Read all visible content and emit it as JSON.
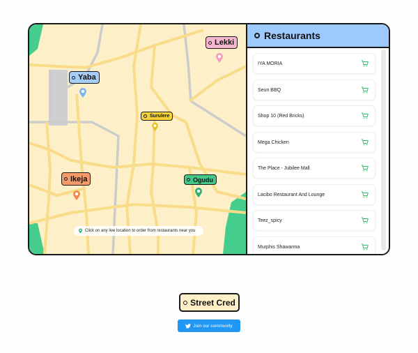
{
  "map": {
    "locations": [
      {
        "label": "Yaba",
        "color": "#a7cdf6",
        "marker_color": "#7ab6f0"
      },
      {
        "label": "Lekki",
        "color": "#f5b6cf",
        "marker_color": "#ef9fbe"
      },
      {
        "label": "Surulere",
        "color": "#f5d235",
        "marker_color": "#e6c229"
      },
      {
        "label": "Ikeja",
        "color": "#f79a6a",
        "marker_color": "#f2884f"
      },
      {
        "label": "Ogudu",
        "color": "#44c88a",
        "marker_color": "#2fb070"
      }
    ],
    "hint": "Click on any live location to order from restaurants near you"
  },
  "panel": {
    "title": "Restaurants",
    "restaurants": [
      "IYA MORIA",
      "Seun BBQ",
      "Shop 10 (Red Bricks)",
      "Mega Chicken",
      "The Place - Jubilee Mall",
      "Lacibo Restaurant And Lounge",
      "Teez_spicy",
      "Murphis Shawarma"
    ]
  },
  "footer": {
    "brand": "Street Cred",
    "join_label": "Join our community"
  },
  "colors": {
    "map_bg": "#fdf0c8",
    "road": "#f8dc8a",
    "highway": "#cccccc",
    "green": "#45cd8d",
    "panel_header": "#9ccafd",
    "cart": "#2fbf71",
    "join_button": "#2196f3"
  }
}
